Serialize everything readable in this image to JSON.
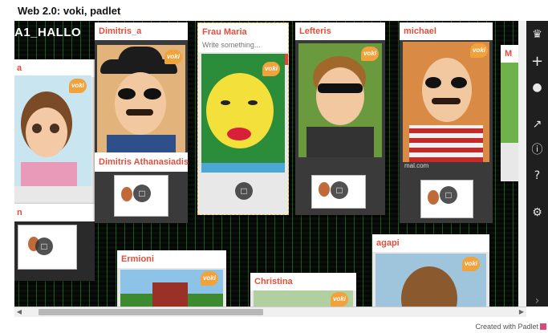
{
  "page": {
    "title": "Web 2.0: voki, padlet"
  },
  "wall": {
    "name": "A1_HALLO"
  },
  "posts": [
    {
      "author": "Dimitris_a",
      "badge": "voki"
    },
    {
      "author": "Frau Maria",
      "badge": "voki",
      "placeholder": "Write something..."
    },
    {
      "author": "Lefteris",
      "badge": "voki"
    },
    {
      "author": "michael",
      "badge": "voki",
      "caption": "mal.com"
    },
    {
      "author": "Dimitris Athanasiadis"
    },
    {
      "author": "agapi",
      "badge": "voki"
    },
    {
      "author": "Ermioni",
      "badge": "voki"
    },
    {
      "author": "Christina",
      "badge": "voki"
    },
    {
      "author": "a",
      "badge": "voki"
    },
    {
      "author": "n"
    },
    {
      "author": "M"
    }
  ],
  "sidebar": {
    "icons": [
      "padlet-logo-icon",
      "add-icon",
      "user-icon",
      "share-icon",
      "info-icon",
      "help-icon",
      "settings-icon",
      "next-icon"
    ]
  },
  "footer": {
    "text": "Created with Padlet"
  }
}
